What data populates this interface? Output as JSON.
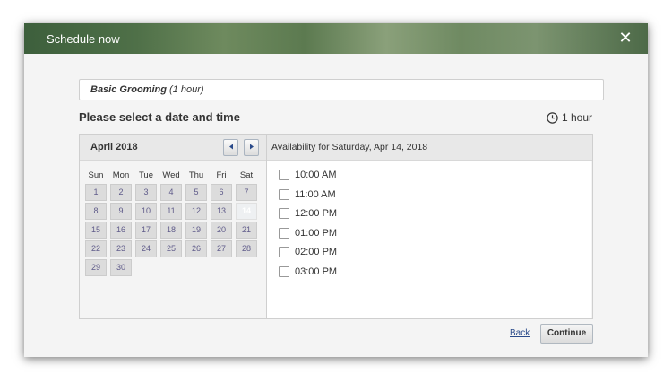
{
  "dialog": {
    "title": "Schedule now",
    "close_glyph": "✕"
  },
  "service": {
    "name": "Basic Grooming",
    "duration": "(1 hour)"
  },
  "heading": "Please select a date and time",
  "duration_label": "1 hour",
  "calendar": {
    "month_title": "April 2018",
    "weekdays": [
      "Sun",
      "Mon",
      "Tue",
      "Wed",
      "Thu",
      "Fri",
      "Sat"
    ],
    "days": [
      "1",
      "2",
      "3",
      "4",
      "5",
      "6",
      "7",
      "8",
      "9",
      "10",
      "11",
      "12",
      "13",
      "14",
      "15",
      "16",
      "17",
      "18",
      "19",
      "20",
      "21",
      "22",
      "23",
      "24",
      "25",
      "26",
      "27",
      "28",
      "29",
      "30"
    ],
    "selected_day": "14"
  },
  "availability": {
    "title": "Availability for Saturday, Apr 14, 2018",
    "slots": [
      "10:00 AM",
      "11:00 AM",
      "12:00 PM",
      "01:00 PM",
      "02:00 PM",
      "03:00 PM"
    ]
  },
  "actions": {
    "back": "Back",
    "continue": "Continue"
  },
  "icons": {
    "close": "close-icon",
    "clock": "clock-icon",
    "prev": "chevron-left-icon",
    "next": "chevron-right-icon"
  }
}
